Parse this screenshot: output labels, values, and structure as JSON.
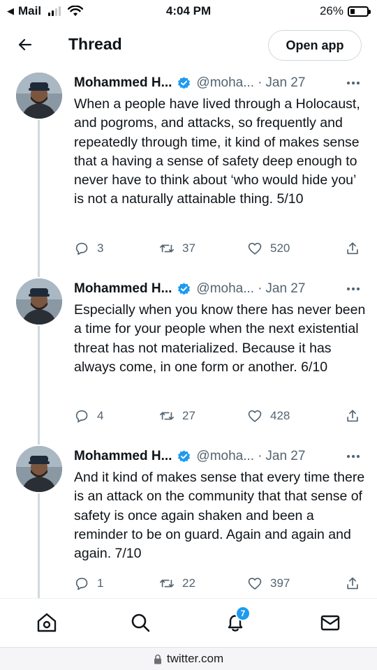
{
  "status_bar": {
    "back_app": "Mail",
    "time": "4:04 PM",
    "battery": "26%",
    "battery_level": 0.26
  },
  "header": {
    "title": "Thread",
    "open_app_label": "Open app"
  },
  "tweets": [
    {
      "name": "Mohammed H...",
      "handle": "@moha...",
      "date": "Jan 27",
      "text": "When a people have lived through a Holocaust, and pogroms, and attacks, so frequently and repeatedly through time, it kind of makes sense that a having a sense of safety deep enough to never have to think about ‘who would hide you’ is not a naturally attainable thing. 5/10",
      "replies": "3",
      "retweets": "37",
      "likes": "520"
    },
    {
      "name": "Mohammed H...",
      "handle": "@moha...",
      "date": "Jan 27",
      "text": "Especially when you know there has never been a time for your people when the next existential threat has not materialized. Because it has always come, in one form or another. 6/10",
      "replies": "4",
      "retweets": "27",
      "likes": "428"
    },
    {
      "name": "Mohammed H...",
      "handle": "@moha...",
      "date": "Jan 27",
      "text": "And it kind of makes sense that every time there is an attack on the community that that sense of safety is once again shaken and been a reminder to be on guard. Again and again and again. 7/10",
      "replies": "1",
      "retweets": "22",
      "likes": "397"
    }
  ],
  "bottom_nav": {
    "notifications_badge": "7"
  },
  "url_bar": {
    "domain": "twitter.com"
  },
  "colors": {
    "accent": "#1d9bf0",
    "text": "#0f1419",
    "secondary": "#536471",
    "thread_line": "#cfd9de"
  }
}
